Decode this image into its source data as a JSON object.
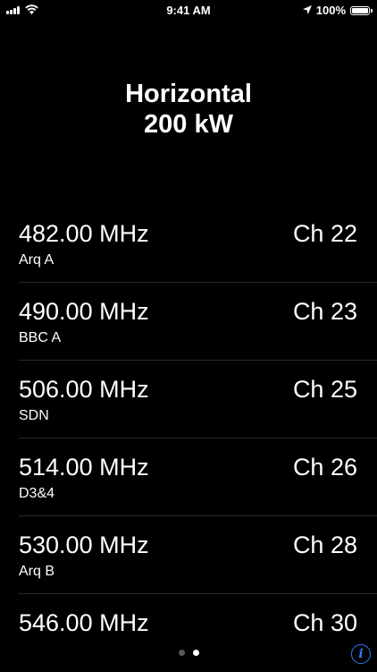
{
  "status_bar": {
    "time": "9:41 AM",
    "battery_percent": "100%",
    "battery_level": 1.0
  },
  "header": {
    "line1": "Horizontal",
    "line2": "200 kW"
  },
  "channels": [
    {
      "frequency": "482.00 MHz",
      "name": "Arq A",
      "channel": "Ch 22"
    },
    {
      "frequency": "490.00 MHz",
      "name": "BBC A",
      "channel": "Ch 23"
    },
    {
      "frequency": "506.00 MHz",
      "name": "SDN",
      "channel": "Ch 25"
    },
    {
      "frequency": "514.00 MHz",
      "name": "D3&4",
      "channel": "Ch 26"
    },
    {
      "frequency": "530.00 MHz",
      "name": "Arq B",
      "channel": "Ch 28"
    },
    {
      "frequency": "546.00 MHz",
      "name": "",
      "channel": "Ch 30"
    }
  ],
  "page_control": {
    "page_count": 2,
    "current_page": 2
  },
  "info_button": {
    "icon": "info-icon",
    "glyph": "i"
  },
  "colors": {
    "background": "#000000",
    "text": "#ffffff",
    "accent": "#2f7cf6",
    "separator": "#2b2b2b"
  }
}
